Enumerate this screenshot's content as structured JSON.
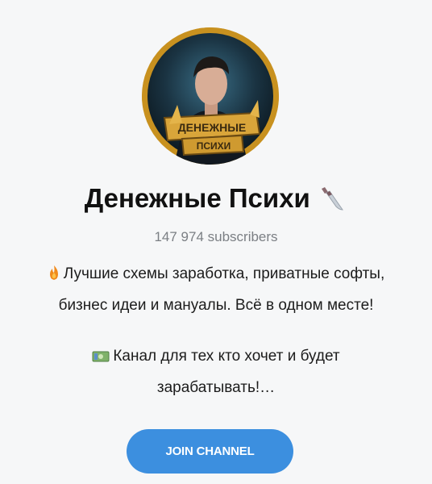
{
  "channel": {
    "title": "Денежные Психи",
    "title_icon": "kitchen-knife-icon",
    "subscribers": "147 974 subscribers",
    "avatar": {
      "banner_line1": "ДЕНЕЖНЫЕ",
      "banner_line2": "ПСИХИ"
    },
    "description": {
      "line1_icon": "fire-icon",
      "line1a": "Лучшие схемы заработка, приватные софты,",
      "line1b": "бизнес идеи и мануалы. Всё в одном месте!",
      "line2_icon": "money-icon",
      "line2a": "Канал для тех кто хочет и будет",
      "line2b": "зарабатывать!…"
    }
  },
  "join_button": {
    "label": "JOIN CHANNEL",
    "color": "#3c8fdf"
  }
}
